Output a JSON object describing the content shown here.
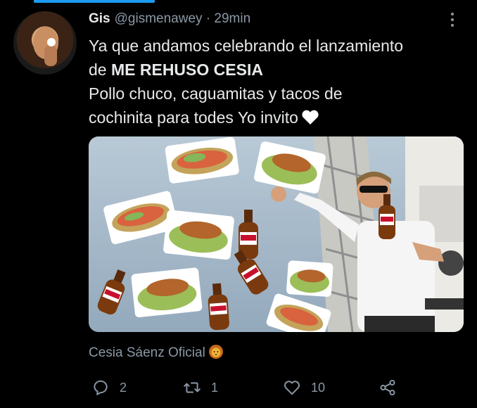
{
  "tweet": {
    "author_name": "Gis",
    "handle_time": "@gismenawey · 29min",
    "text_line1": "Ya que andamos celebrando el lanzamiento",
    "text_line2_prefix": "de ",
    "text_line2_bold": "ME REHUSO CESIA",
    "text_body": " Pollo chuco, caguamitas y tacos de\ncochinita para todes Yo invito",
    "source_name": "Cesia Sáenz Oficial"
  },
  "media": {
    "bottle_label": "CARTA BLANCA"
  },
  "actions": {
    "reply_count": "2",
    "retweet_count": "1",
    "like_count": "10"
  },
  "colors": {
    "background": "#000000",
    "text": "#e7e9ea",
    "muted": "#8b98a5",
    "accent": "#1d9bf0"
  },
  "icons": [
    "more-icon",
    "heart-emoji-icon",
    "lion-emoji-icon",
    "reply-icon",
    "retweet-icon",
    "like-icon",
    "share-icon"
  ]
}
